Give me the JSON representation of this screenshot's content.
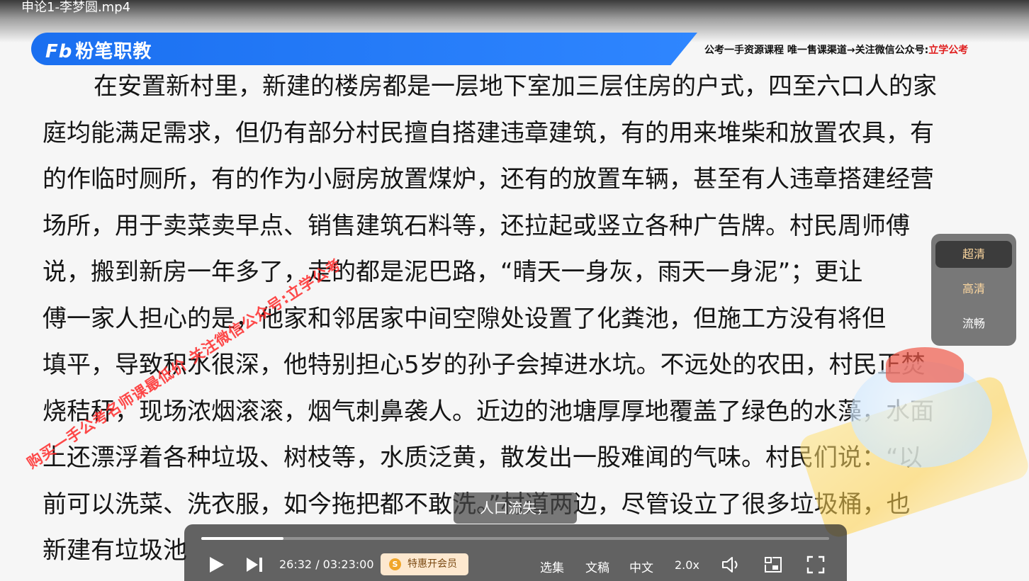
{
  "player": {
    "title": "申论1-李梦圆.mp4"
  },
  "banner": {
    "logo_mark": "Fb",
    "logo_text": "粉笔职教",
    "notice_prefix": "公考一手资源课程 唯一售课渠道→关注微信公众号:",
    "notice_highlight": "立学公考",
    "brand_color": "#1a6ff0"
  },
  "content": {
    "lines": [
      "在安置新村里，新建的楼房都是一层地下室加三层住房的户式，四至六口人的家",
      "庭均能满足需求，但仍有部分村民擅自搭建违章建筑，有的用来堆柴和放置农具，有",
      "的作临时厕所，有的作为小厨房放置煤炉，还有的放置车辆，甚至有人违章搭建经营",
      "场所，用于卖菜卖早点、销售建筑石料等，还拉起或竖立各种广告牌。村民周师傅",
      "说，搬到新房一年多了，走的都是泥巴路，“晴天一身灰，雨天一身泥”；更让",
      "傅一家人担心的是，他家和邻居家中间空隙处设置了化粪池，但施工方没有将但",
      "填平，导致积水很深，他特别担心5岁的孙子会掉进水坑。不远处的农田，村民正焚",
      "烧秸秆，现场浓烟滚滚，烟气刺鼻袭人。近边的池塘厚厚地覆盖了绿色的水藻，水面",
      "上还漂浮着各种垃圾、树枝等，水质泛黄，散发出一股难闻的气味。村民们说：“以",
      "前可以洗菜、洗衣服，如今拖把都不敢洗。”村道两边，尽管设立了很多垃圾桶，也",
      "新建有垃圾池"
    ]
  },
  "watermark": {
    "text": "购买一手公考名师课最低价 关注微信公众号:立学公考"
  },
  "quality_menu": {
    "options": [
      "超清",
      "高清",
      "流畅"
    ],
    "selected": "超清"
  },
  "subtitle": {
    "text": "人口流失，"
  },
  "controls": {
    "current_time": "26:32",
    "total_time": "03:23:00",
    "time_separator": " / ",
    "progress_fraction": 0.131,
    "vip_label": "特惠开会员",
    "vip_coin": "S",
    "episodes_label": "选集",
    "transcript_label": "文稿",
    "language_label": "中文",
    "speed_label": "2.0x",
    "icons": [
      "play-icon",
      "next-icon",
      "volume-icon",
      "picture-in-picture-icon",
      "fullscreen-icon"
    ]
  }
}
